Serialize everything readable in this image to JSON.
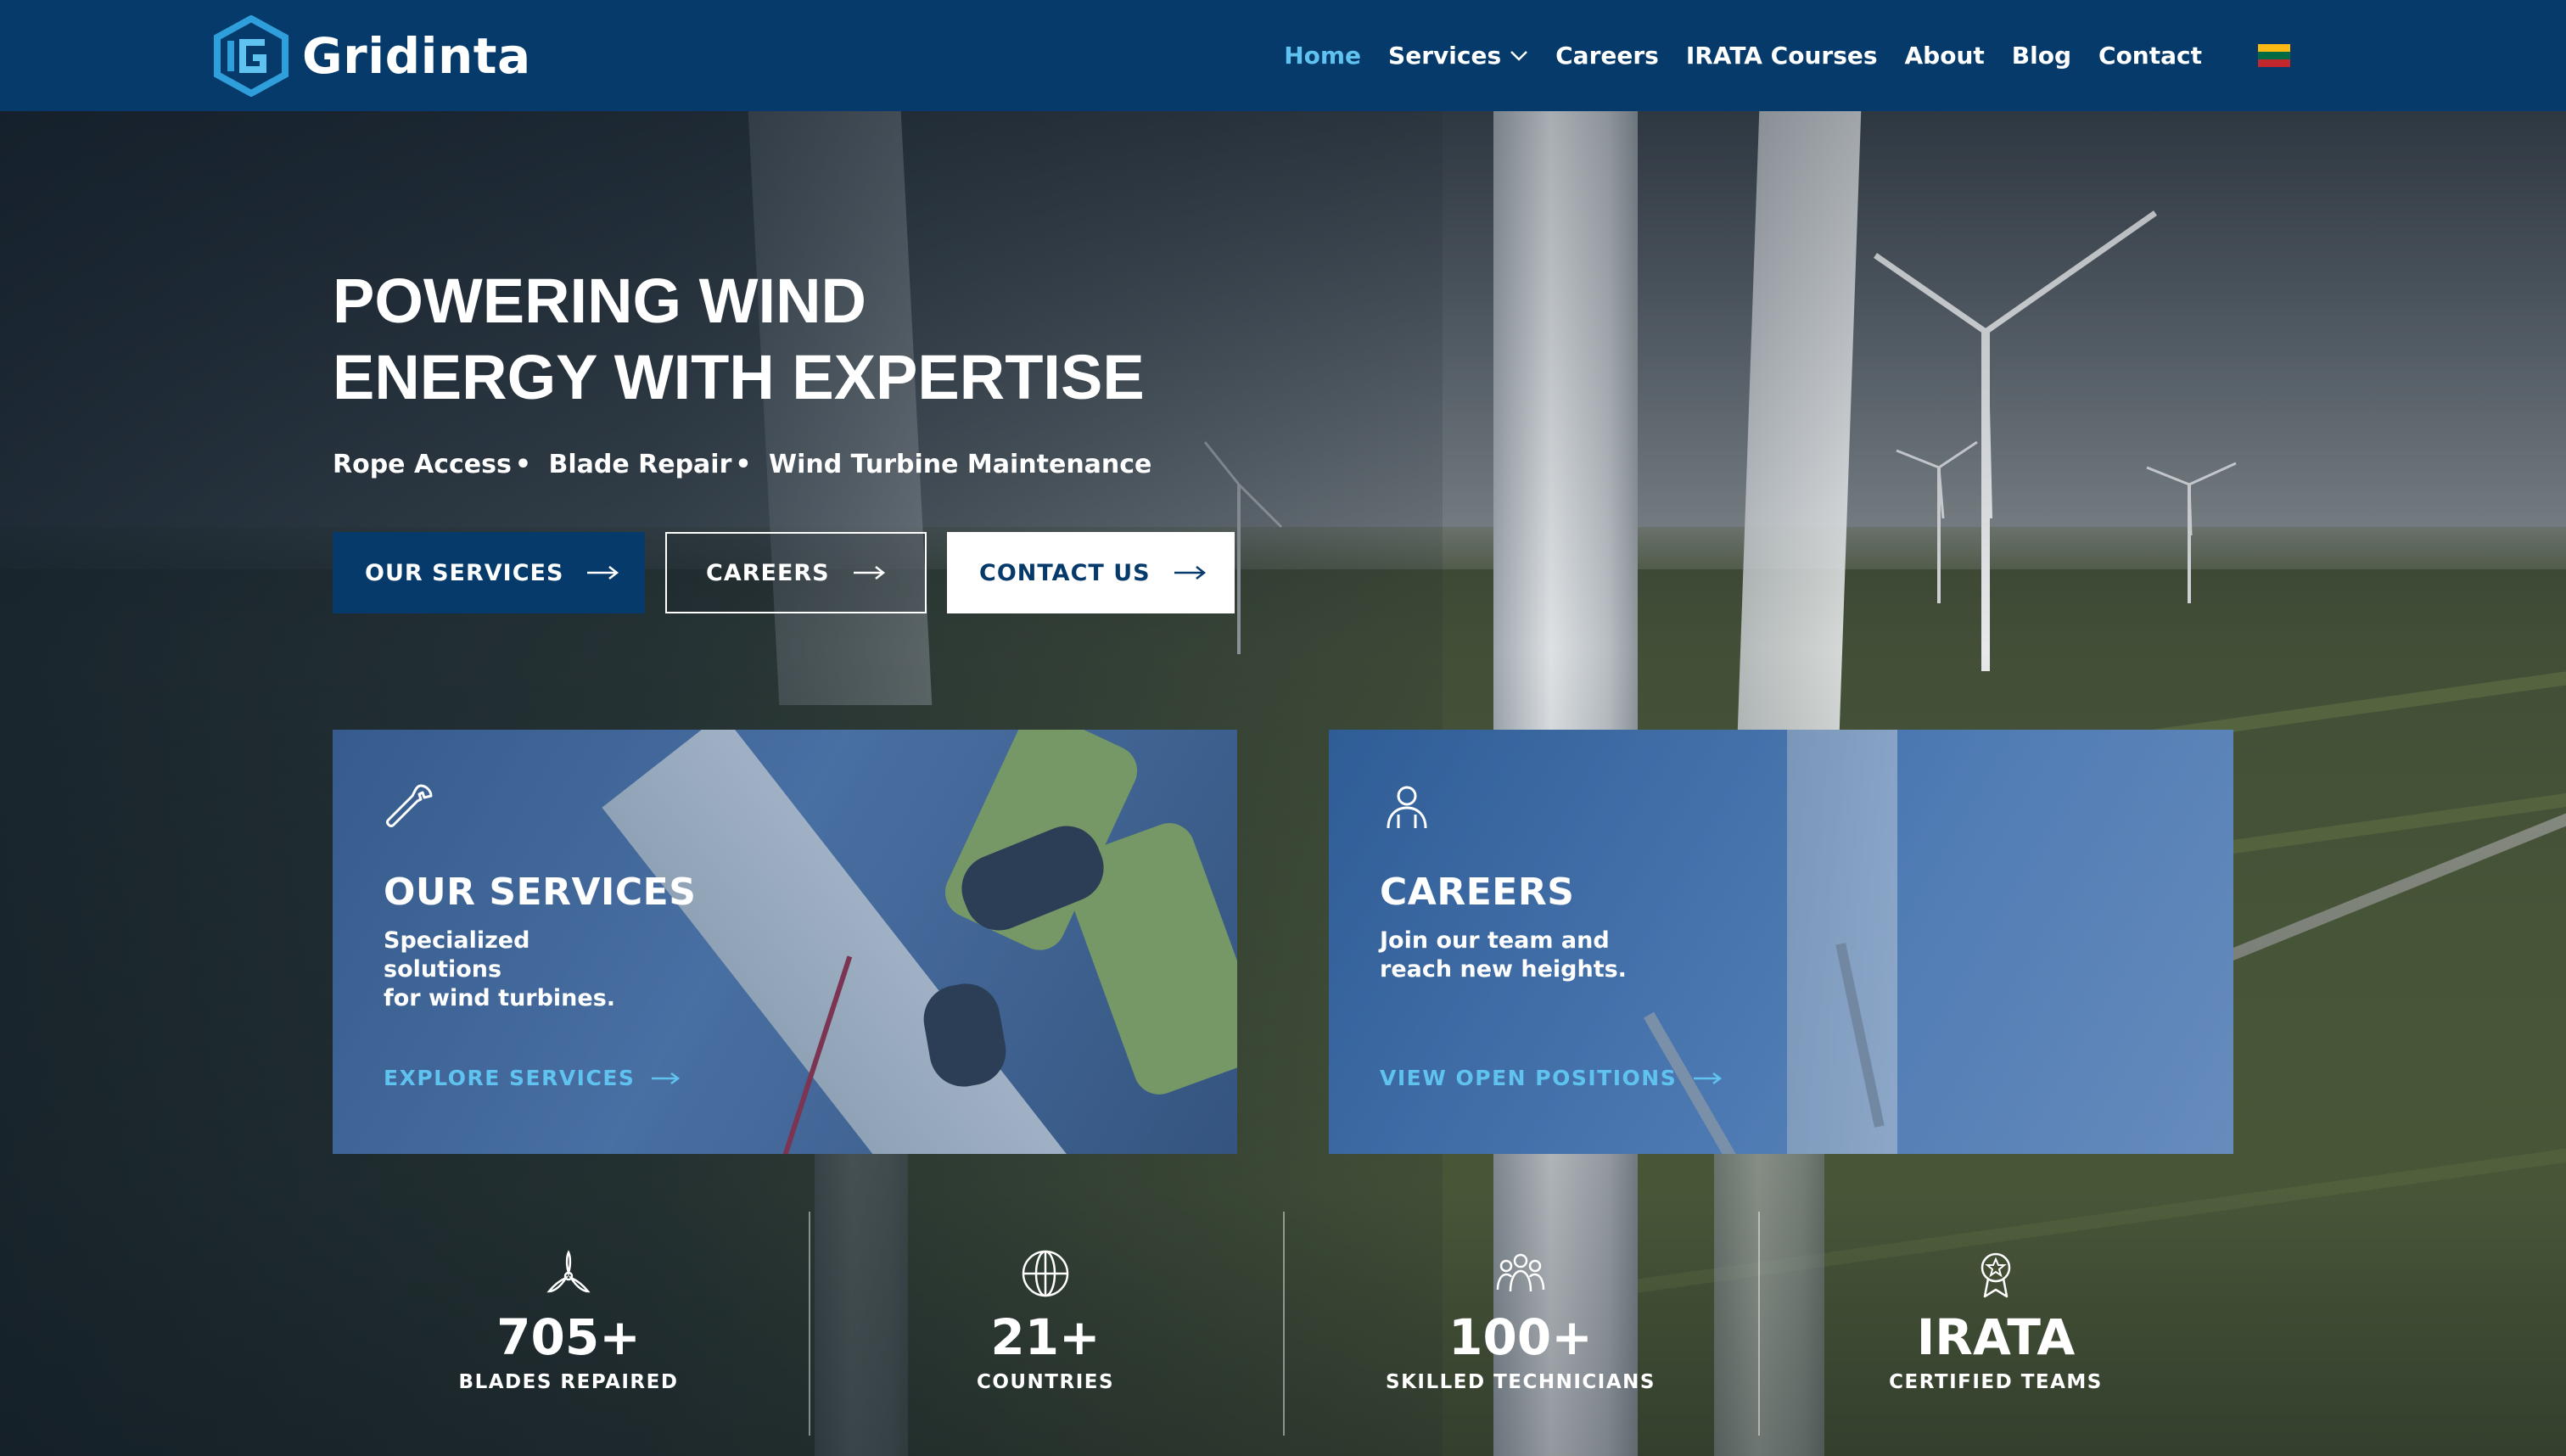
{
  "brand": {
    "name": "Gridinta"
  },
  "nav": {
    "items": [
      {
        "label": "Home",
        "active": true
      },
      {
        "label": "Services",
        "dropdown": true
      },
      {
        "label": "Careers"
      },
      {
        "label": "IRATA Courses"
      },
      {
        "label": "About"
      },
      {
        "label": "Blog"
      },
      {
        "label": "Contact"
      }
    ],
    "language_flag": "lithuania-flag",
    "flag_colors": [
      "#fdb913",
      "#006a44",
      "#c1272d"
    ]
  },
  "hero": {
    "title_line1": "POWERING WIND",
    "title_line2": "ENERGY WITH EXPERTISE",
    "subtitle_items": [
      "Rope Access",
      "Blade Repair",
      "Wind Turbine Maintenance"
    ],
    "separator": "•",
    "buttons": {
      "services": "OUR SERVICES",
      "careers": "CAREERS",
      "contact": "CONTACT US"
    }
  },
  "cards": {
    "services": {
      "icon": "wrench-icon",
      "title": "OUR SERVICES",
      "desc_line1": "Specialized solutions",
      "desc_line2": "for wind turbines.",
      "link": "EXPLORE SERVICES"
    },
    "careers": {
      "icon": "person-icon",
      "title": "CAREERS",
      "desc_line1": "Join our team and",
      "desc_line2": "reach new heights.",
      "link": "VIEW OPEN POSITIONS"
    }
  },
  "stats": [
    {
      "icon": "turbine-icon",
      "value": "705+",
      "label": "BLADES REPAIRED"
    },
    {
      "icon": "globe-icon",
      "value": "21+",
      "label": "COUNTRIES"
    },
    {
      "icon": "team-icon",
      "value": "100+",
      "label": "SKILLED TECHNICIANS"
    },
    {
      "icon": "certificate-icon",
      "value": "IRATA",
      "label": "CERTIFIED TEAMS"
    }
  ],
  "colors": {
    "brand_navy": "#053a6b",
    "accent_cyan": "#5fc2ef",
    "white": "#ffffff"
  }
}
